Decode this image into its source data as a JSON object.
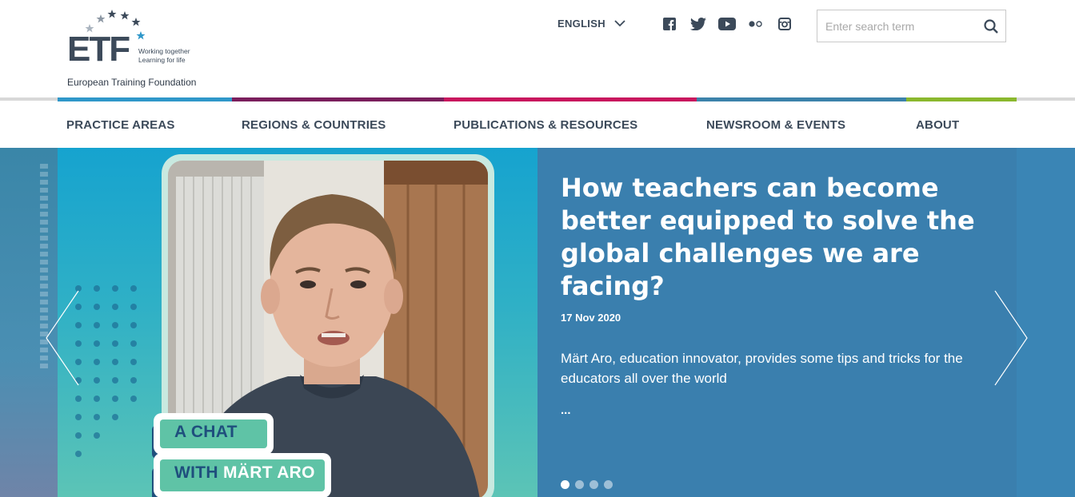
{
  "header": {
    "logo": {
      "mark": "ETF",
      "tagline_line1": "Working together",
      "tagline_line2": "Learning for life",
      "organization": "European Training Foundation"
    },
    "language": {
      "label": "ENGLISH",
      "icon": "chevron-down-icon"
    },
    "social": [
      {
        "name": "facebook-icon"
      },
      {
        "name": "twitter-icon"
      },
      {
        "name": "youtube-icon"
      },
      {
        "name": "flickr-icon"
      },
      {
        "name": "instagram-icon"
      }
    ],
    "search": {
      "placeholder": "Enter search term",
      "value": "",
      "icon": "search-icon"
    }
  },
  "colorbar": [
    "#2f97c9",
    "#7a1e5c",
    "#c8175d",
    "#3c82aa",
    "#8ab82d"
  ],
  "nav": [
    {
      "label": "PRACTICE AREAS"
    },
    {
      "label": "REGIONS & COUNTRIES"
    },
    {
      "label": "PUBLICATIONS & RESOURCES"
    },
    {
      "label": "NEWSROOM & EVENTS"
    },
    {
      "label": "ABOUT"
    }
  ],
  "slide": {
    "title": "How teachers can become better equipped to solve the global challenges we are facing?",
    "date": "17 Nov 2020",
    "summary": "Märt Aro, education innovator, provides some tips and tricks for the educators all over the world",
    "more": "...",
    "badge_line1": "A CHAT",
    "badge_line2_a": "WITH ",
    "badge_line2_b": "MÄRT ARO",
    "pager_count": 4,
    "pager_active": 1,
    "prev_icon": "chevron-left-icon",
    "next_icon": "chevron-right-icon"
  },
  "colors": {
    "brand_text": "#3c4a5a",
    "slide_panel": "#3a7fae",
    "badge_green": "#5fc3a6",
    "badge_navy": "#1f4f7d"
  }
}
